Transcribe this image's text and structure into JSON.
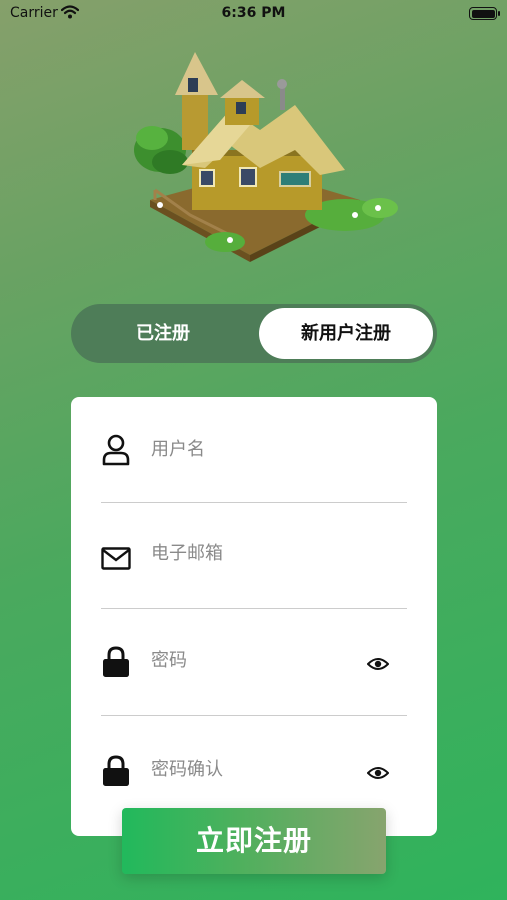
{
  "status_bar": {
    "carrier": "Carrier",
    "time": "6:36 PM",
    "battery_level": 1.0
  },
  "hero": {
    "icon": "treehouse-illustration"
  },
  "segment": {
    "registered_label": "已注册",
    "new_user_label": "新用户注册",
    "selected": "new_user"
  },
  "form": {
    "username_placeholder": "用户名",
    "email_placeholder": "电子邮箱",
    "password_placeholder": "密码",
    "confirm_password_placeholder": "密码确认"
  },
  "submit_label": "立即注册",
  "colors": {
    "accent_green": "#21b95c",
    "segment_bg": "#4e7d58",
    "card_bg": "#ffffff",
    "placeholder_text": "#8a8a8a"
  }
}
